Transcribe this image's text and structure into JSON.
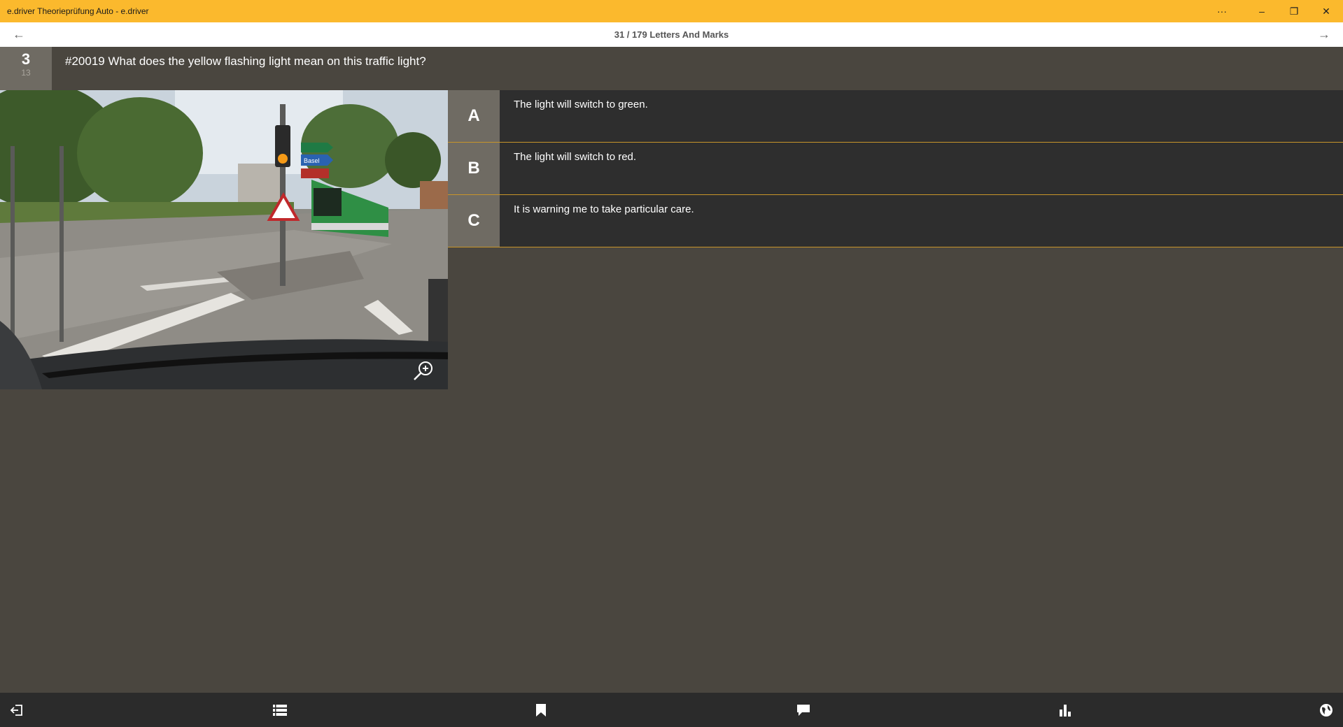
{
  "window": {
    "title": "e.driver Theorieprüfung Auto - e.driver",
    "more_label": "···",
    "minimize_label": "–",
    "maximize_label": "❐",
    "close_label": "✕"
  },
  "nav": {
    "title": "31 / 179 Letters And Marks",
    "back_label": "←",
    "forward_label": "→"
  },
  "question": {
    "number_big": "3",
    "number_small": "13",
    "text": "#20019 What does the yellow flashing light mean on this traffic light?"
  },
  "answers": [
    {
      "letter": "A",
      "text": "The light will switch to green."
    },
    {
      "letter": "B",
      "text": "The light will switch to red."
    },
    {
      "letter": "C",
      "text": "It is warning me to take particular care."
    }
  ],
  "photo": {
    "signs": [
      "Basel"
    ]
  },
  "bottom_bar": {
    "icons": [
      "exit-icon",
      "list-icon",
      "bookmark-icon",
      "comment-icon",
      "stats-icon",
      "language-icon"
    ]
  },
  "colors": {
    "accent": "#fbb92d",
    "background": "#4a463f",
    "answer_bg": "#2e2e2e",
    "letter_bg": "#6f6b63",
    "separator": "#c8952a"
  }
}
